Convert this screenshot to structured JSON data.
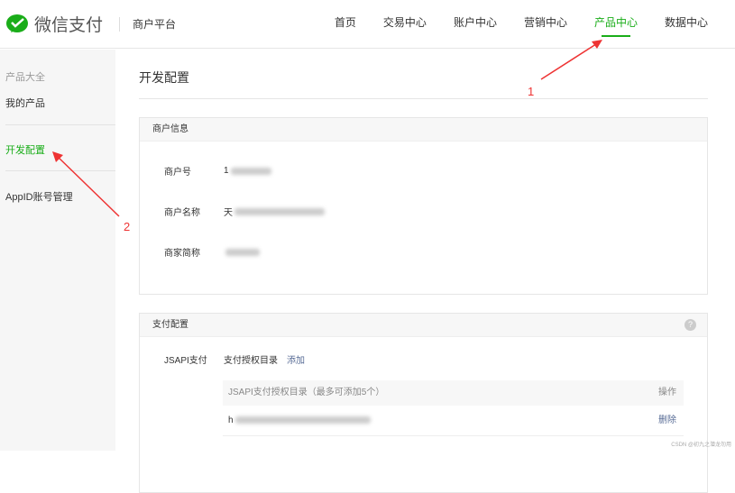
{
  "header": {
    "brand": "微信支付",
    "platform": "商户平台",
    "nav": [
      {
        "label": "首页"
      },
      {
        "label": "交易中心"
      },
      {
        "label": "账户中心"
      },
      {
        "label": "营销中心"
      },
      {
        "label": "产品中心",
        "active": true
      },
      {
        "label": "数据中心"
      }
    ]
  },
  "sidebar": {
    "group": "产品大全",
    "items": [
      {
        "label": "我的产品"
      },
      {
        "label": "开发配置",
        "active": true
      },
      {
        "label": "AppID账号管理"
      }
    ]
  },
  "main": {
    "title": "开发配置",
    "merchant": {
      "title": "商户信息",
      "fields": [
        {
          "label": "商户号",
          "value_prefix": "1"
        },
        {
          "label": "商户名称",
          "value_prefix": "天"
        },
        {
          "label": "商家简称",
          "value_prefix": ""
        }
      ]
    },
    "pay": {
      "title": "支付配置",
      "help": "?",
      "jsapi_label": "JSAPI支付",
      "dir_label": "支付授权目录",
      "add": "添加",
      "table": {
        "header": "JSAPI支付授权目录（最多可添加5个）",
        "op": "操作",
        "rows": [
          {
            "url_prefix": "h",
            "delete": "删除"
          }
        ]
      }
    }
  },
  "annotations": [
    "1",
    "2"
  ],
  "watermark": "CSDN @初九之潜龙勿用",
  "colors": {
    "accent": "#1aad19",
    "link": "#576b95",
    "arrow": "#e33333"
  }
}
